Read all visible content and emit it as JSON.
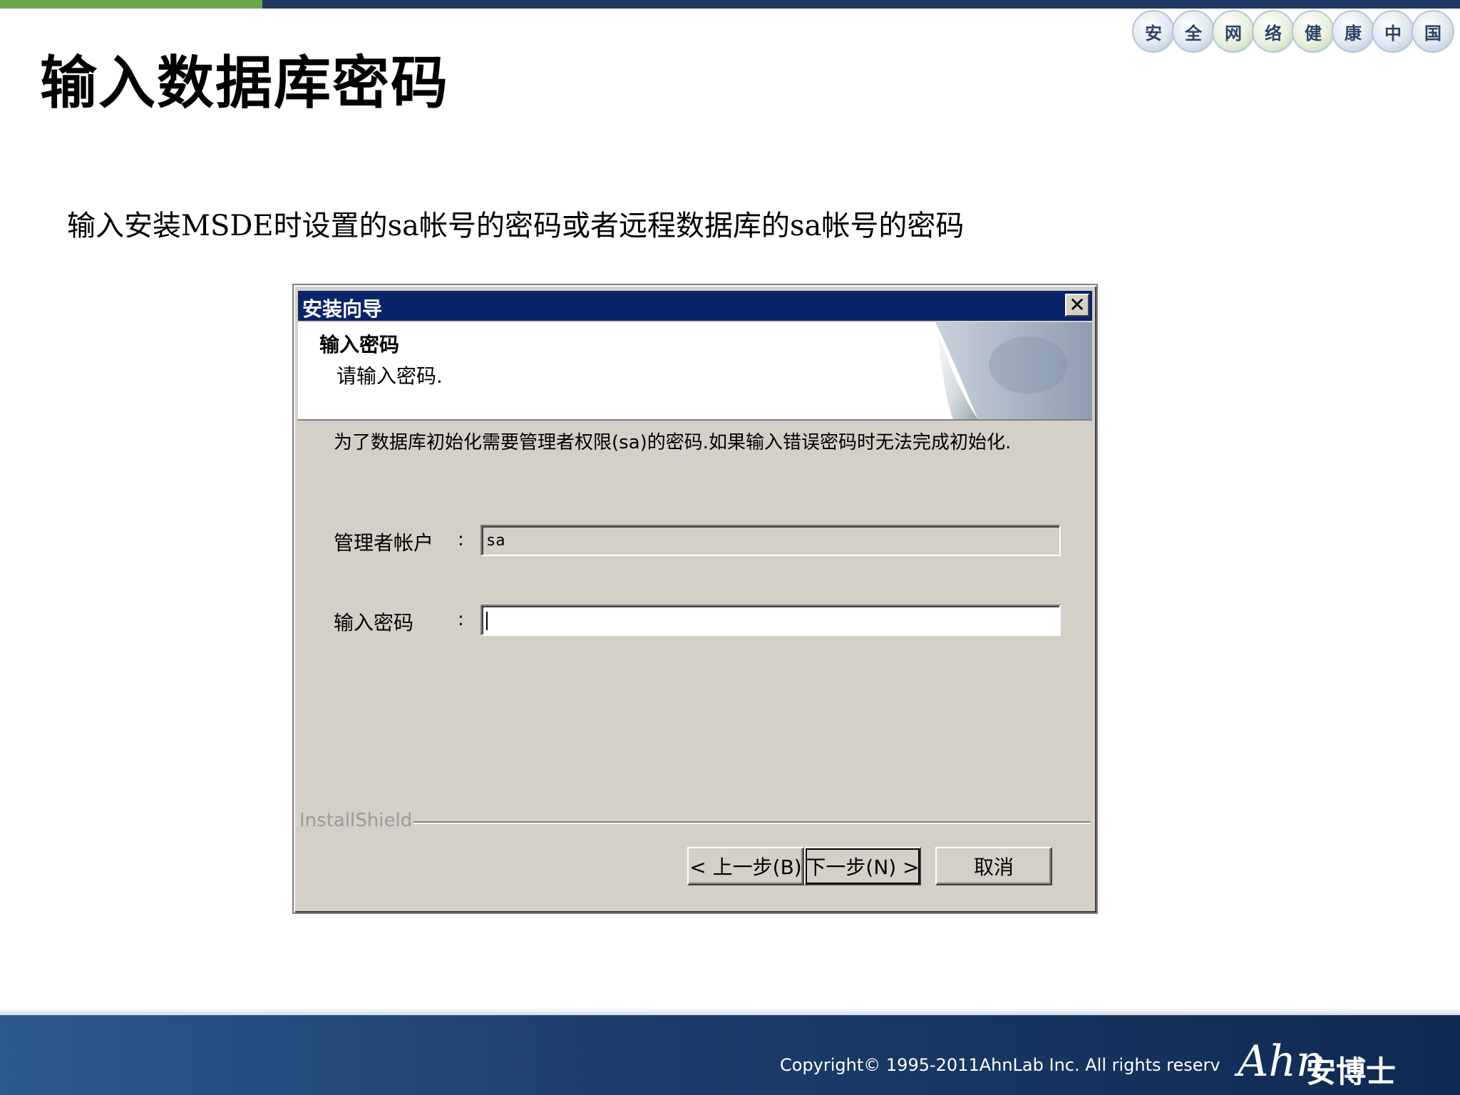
{
  "slide": {
    "title": "输入数据库密码",
    "subtitle": "输入安装MSDE时设置的sa帐号的密码或者远程数据库的sa帐号的密码",
    "badges": [
      "安",
      "全",
      "网",
      "络",
      "健",
      "康",
      "中",
      "国"
    ]
  },
  "dialog": {
    "title": "安装向导",
    "header_title": "输入密码",
    "header_subtitle": "请输入密码.",
    "description": "为了数据库初始化需要管理者权限(sa)的密码.如果输入错误密码时无法完成初始化.",
    "fields": {
      "account_label": "管理者帐户",
      "account_value": "sa",
      "password_label": "输入密码",
      "password_value": "",
      "colon": ":"
    },
    "brand": "InstallShield",
    "buttons": {
      "back": "< 上一步(B)",
      "next": "下一步(N) >",
      "cancel": "取消"
    }
  },
  "footer": {
    "copyright": "Copyright© 1995-2011AhnLab Inc. All rights reserv",
    "logo_latin": "Ahn",
    "logo_cn": "安博士"
  },
  "colors": {
    "titlebar": "#0a246a",
    "dialog_face": "#d4d0c8",
    "footer": "#1d3f6e",
    "accent_green": "#6aa84f"
  }
}
